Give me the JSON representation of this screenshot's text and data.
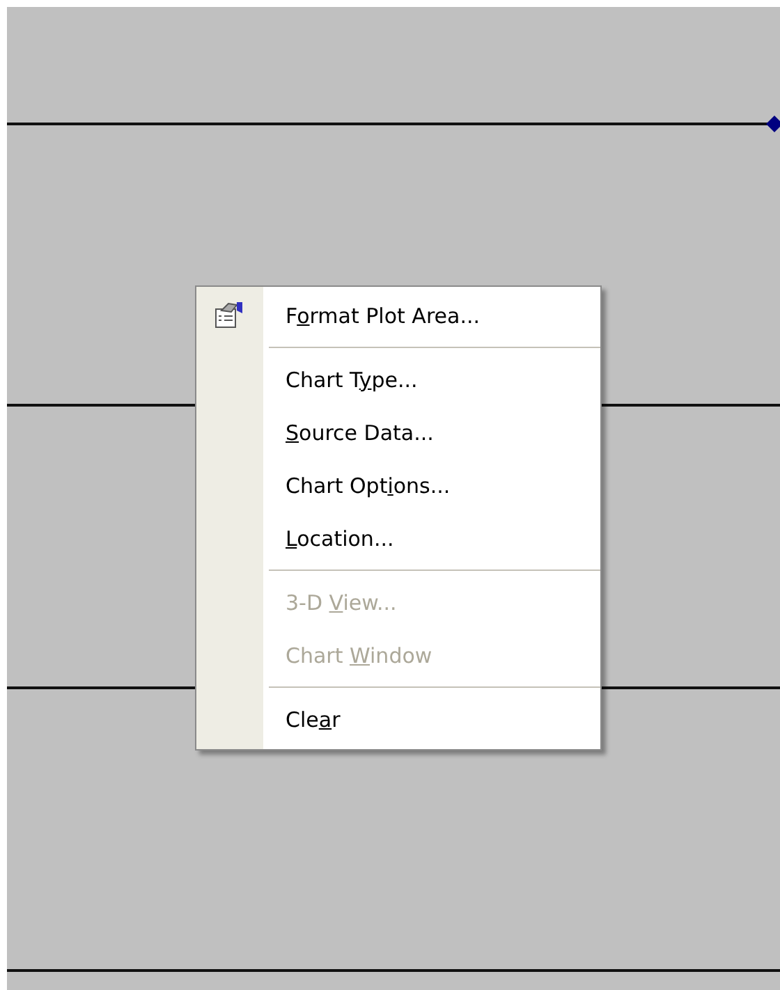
{
  "context_menu": {
    "items": [
      {
        "kind": "item",
        "has_icon": true,
        "disabled": false,
        "before": "F",
        "mnemonic": "o",
        "after": "rmat Plot Area..."
      },
      {
        "kind": "separator"
      },
      {
        "kind": "item",
        "has_icon": false,
        "disabled": false,
        "before": "Chart T",
        "mnemonic": "y",
        "after": "pe..."
      },
      {
        "kind": "item",
        "has_icon": false,
        "disabled": false,
        "mnemonic": "S",
        "after": "ource Data..."
      },
      {
        "kind": "item",
        "has_icon": false,
        "disabled": false,
        "before": "Chart Opt",
        "mnemonic": "i",
        "after": "ons..."
      },
      {
        "kind": "item",
        "has_icon": false,
        "disabled": false,
        "mnemonic": "L",
        "after": "ocation..."
      },
      {
        "kind": "separator"
      },
      {
        "kind": "item",
        "has_icon": false,
        "disabled": true,
        "before": "3-D ",
        "mnemonic": "V",
        "after": "iew..."
      },
      {
        "kind": "item",
        "has_icon": false,
        "disabled": true,
        "before": "Chart ",
        "mnemonic": "W",
        "after": "indow"
      },
      {
        "kind": "separator"
      },
      {
        "kind": "item",
        "has_icon": false,
        "disabled": false,
        "before": "Cle",
        "mnemonic": "a",
        "after": "r"
      }
    ]
  }
}
